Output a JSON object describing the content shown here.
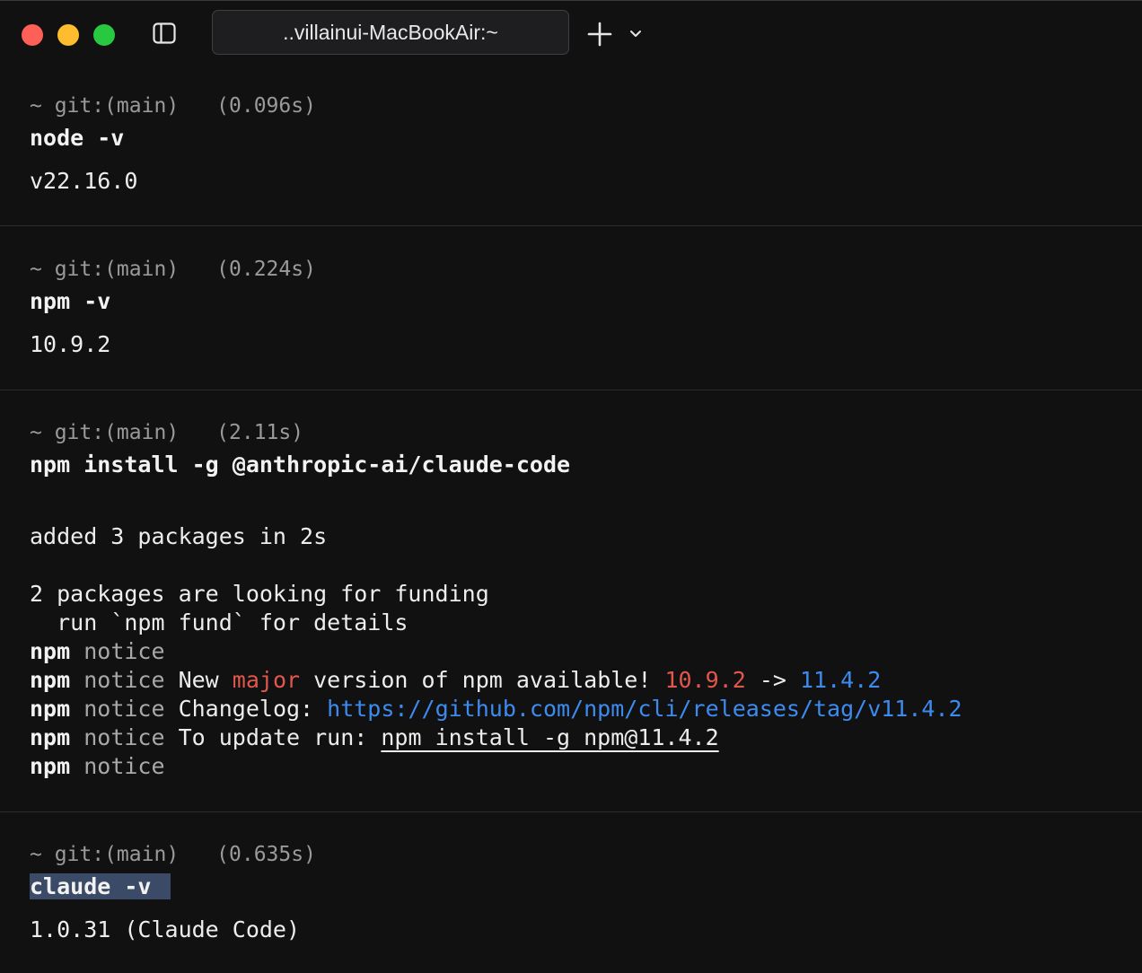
{
  "window": {
    "tab_title": "..villainui-MacBookAir:~"
  },
  "icons": {
    "close": "close-window-icon",
    "minimize": "minimize-window-icon",
    "zoom": "zoom-window-icon",
    "sidebar": "sidebar-toggle-icon",
    "new_tab": "plus-icon",
    "tab_menu": "chevron-down-icon"
  },
  "colors": {
    "background": "#111112",
    "prompt": "#9a9a9a",
    "version_old": "#e2574c",
    "version_new": "#3d8bf0",
    "selection": "#3b4a66"
  },
  "blocks": [
    {
      "prompt_dir": "~ git:(main)",
      "duration": "(0.096s)",
      "command": "node -v",
      "output": "v22.16.0"
    },
    {
      "prompt_dir": "~ git:(main)",
      "duration": "(0.224s)",
      "command": "npm -v",
      "output": "10.9.2"
    },
    {
      "prompt_dir": "~ git:(main)",
      "duration": "(2.11s)",
      "command": "npm install -g @anthropic-ai/claude-code",
      "output": {
        "added": "added 3 packages in 2s",
        "funding_1": "2 packages are looking for funding",
        "funding_2": "  run `npm fund` for details",
        "npm": "npm",
        "notice": "notice",
        "new_prefix": " New ",
        "major": "major",
        "version_text": " version of npm available! ",
        "old_version": "10.9.2",
        "arrow": " -> ",
        "new_version": "11.4.2",
        "changelog_label": " Changelog: ",
        "changelog_url": "https://github.com/npm/cli/releases/tag/v11.4.2",
        "update_label": " To update run: ",
        "update_command": "npm install -g npm@11.4.2"
      }
    },
    {
      "prompt_dir": "~ git:(main)",
      "duration": "(0.635s)",
      "command": "claude -v",
      "output": "1.0.31 (Claude Code)"
    }
  ]
}
